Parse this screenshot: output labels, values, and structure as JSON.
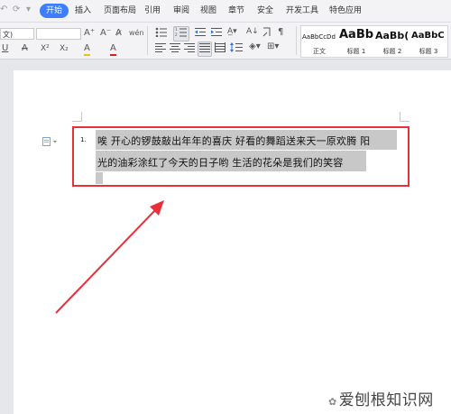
{
  "menubar": {
    "quick_access": [
      "↶",
      "⟳",
      "▾"
    ],
    "tabs": [
      {
        "label": "开始",
        "active": true
      },
      {
        "label": "插入"
      },
      {
        "label": "页面布局"
      },
      {
        "label": "引用"
      },
      {
        "label": "审阅"
      },
      {
        "label": "视图"
      },
      {
        "label": "章节"
      },
      {
        "label": "安全"
      },
      {
        "label": "开发工具"
      },
      {
        "label": "特色应用"
      }
    ]
  },
  "ribbon": {
    "font_name": "文)",
    "font_size": "",
    "row1_font_tools": [
      "A⁺",
      "A⁻",
      "A̷",
      "wén"
    ],
    "row2_font_tools": [
      "U",
      "A",
      "X²",
      "X₂",
      "A",
      "A"
    ],
    "styles": [
      {
        "preview": "AaBbCcDd",
        "name": "正文"
      },
      {
        "preview": "AaBb",
        "name": "标题 1"
      },
      {
        "preview": "AaBb(",
        "name": "标题 2"
      },
      {
        "preview": "AaBbC",
        "name": "标题 3"
      }
    ]
  },
  "document": {
    "list_number": "1.",
    "lines": [
      "唉  开心的锣鼓敲出年年的喜庆  好看的舞蹈送来天一原欢腾  阳",
      "光的油彩涂红了今天的日子哟  生活的花朵是我们的笑容"
    ]
  },
  "watermark": {
    "text": "爱刨根知识网"
  },
  "colors": {
    "accent": "#3d7eff",
    "callout": "#e8303a",
    "selection": "#c8c8c8"
  }
}
